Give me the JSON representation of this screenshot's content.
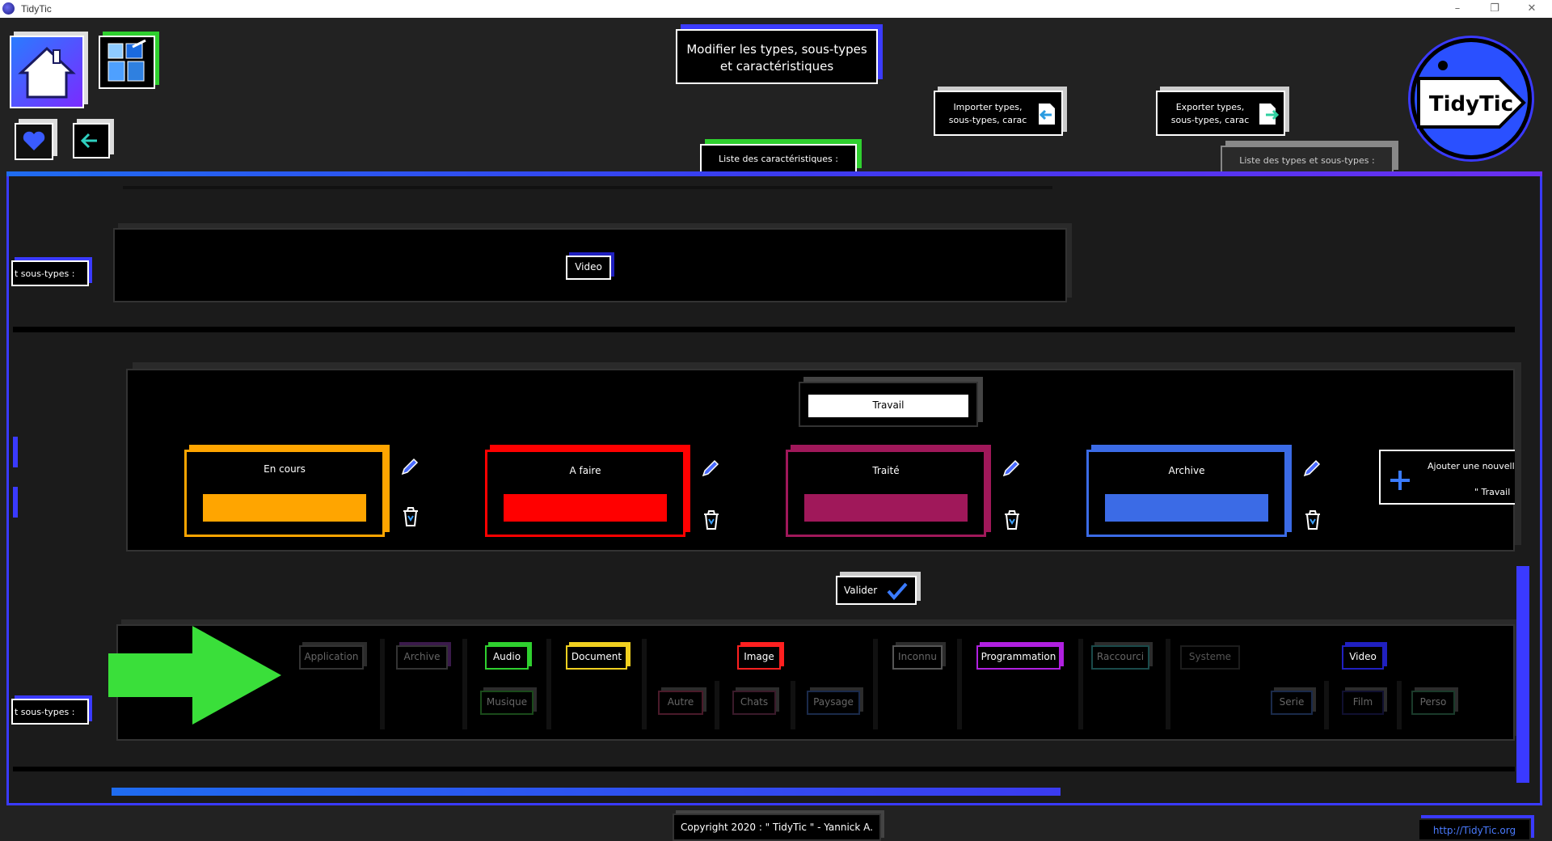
{
  "window": {
    "title": "TidyTic",
    "controls": [
      "–",
      "❐",
      "✕"
    ]
  },
  "header": {
    "title_line1": "Modifier les types, sous-types",
    "title_line2": "et caractéristiques",
    "import_line1": "Importer types,",
    "import_line2": "sous-types, carac",
    "export_line1": "Exporter types,",
    "export_line2": "sous-types, carac",
    "tab_carac": "Liste des caractéristiques :",
    "tab_types": "Liste des types et sous-types :",
    "logo_text": "TidyTic"
  },
  "left_tabs": {
    "upper": "t sous-types :",
    "lower": "t sous-types :"
  },
  "row_video": {
    "tag": "Video"
  },
  "editor": {
    "type_name": "Travail",
    "statuses": [
      {
        "name": "En cours",
        "color": "#ffa500"
      },
      {
        "name": "A faire",
        "color": "#ff0000"
      },
      {
        "name": "Traité",
        "color": "#a0185a"
      },
      {
        "name": "Archive",
        "color": "#3b6be6"
      }
    ],
    "add_line1": "Ajouter une nouvell",
    "add_line2": "\" Travail",
    "validate": "Valider"
  },
  "types_row": {
    "top": [
      "Application",
      "Archive",
      "Audio",
      "Document",
      "Image",
      "Inconnu",
      "Programmation",
      "Raccourci",
      "Systeme",
      "Video"
    ],
    "bottom": [
      "Musique",
      "Autre",
      "Chats",
      "Paysage",
      "Serie",
      "Film",
      "Perso"
    ]
  },
  "footer": {
    "copyright": "Copyright 2020 : \" TidyTic \" - Yannick A.",
    "link": "http://TidyTic.org"
  }
}
